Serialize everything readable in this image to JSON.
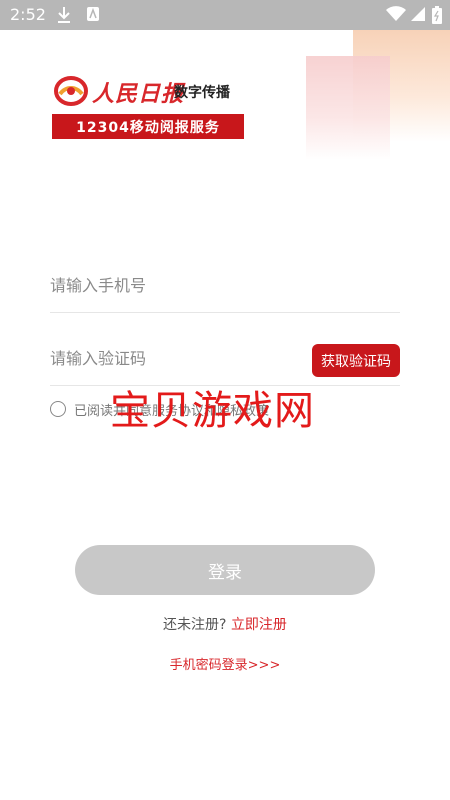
{
  "status_bar": {
    "time": "2:52",
    "icons": [
      "download-icon",
      "app-icon",
      "wifi-icon",
      "signal-icon",
      "battery-icon"
    ]
  },
  "logo": {
    "calligraphy": "人民日报",
    "subtitle": "数字传播",
    "banner": "12304移动阅报服务"
  },
  "form": {
    "phone_placeholder": "请输入手机号",
    "code_placeholder": "请输入验证码",
    "get_code_label": "获取验证码",
    "agreement_text": "已阅读并同意服务协议和隐私政策"
  },
  "watermark": "宝贝游戏网",
  "login_label": "登录",
  "register_question": "还未注册?",
  "register_link": "立即注册",
  "password_login": "手机密码登录>>>",
  "colors": {
    "accent": "#c8171b",
    "disabled_button": "#c8c8c8"
  }
}
